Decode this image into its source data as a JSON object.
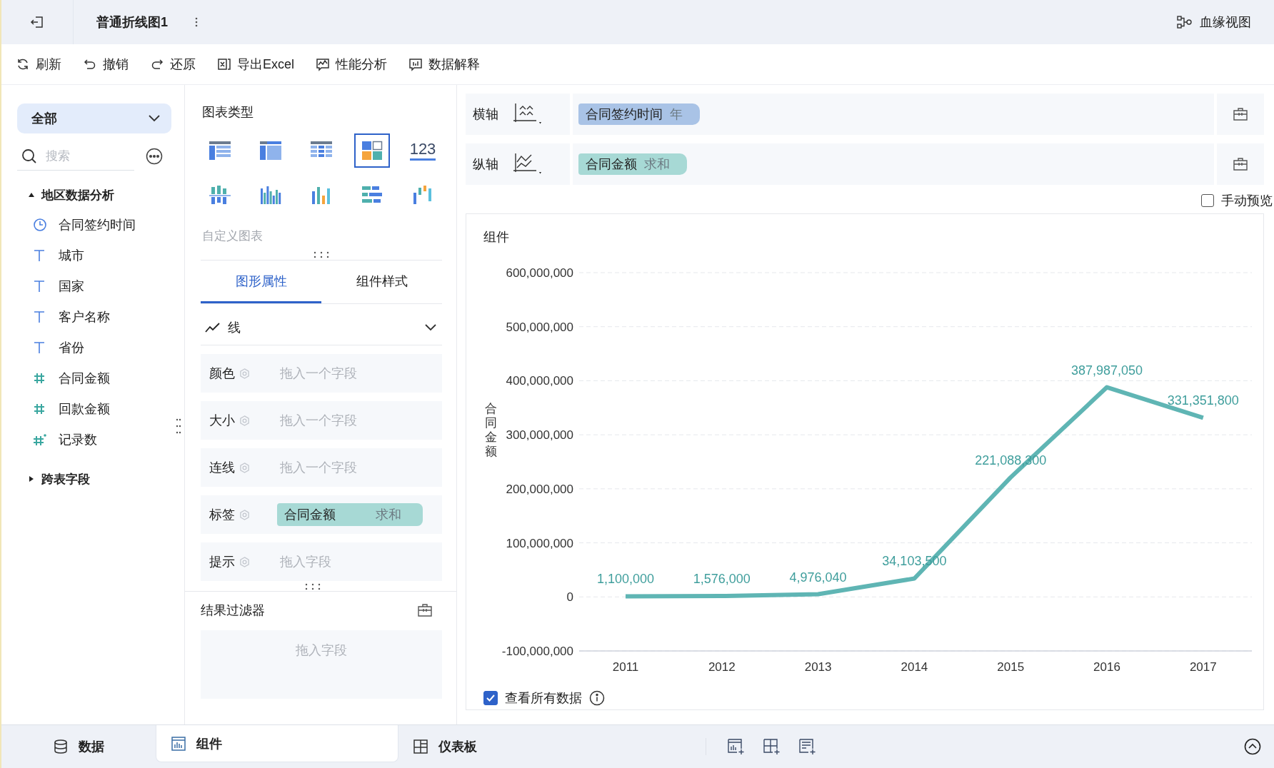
{
  "header": {
    "title": "普通折线图1",
    "lineage": "血缘视图"
  },
  "toolbar": [
    {
      "label": "刷新",
      "kind": "refresh"
    },
    {
      "label": "撤销",
      "kind": "undo"
    },
    {
      "label": "还原",
      "kind": "redo"
    },
    {
      "label": "导出Excel",
      "kind": "excel"
    },
    {
      "label": "性能分析",
      "kind": "performance"
    },
    {
      "label": "数据解释",
      "kind": "explain"
    }
  ],
  "data_panel": {
    "dropdown": "全部",
    "search": {
      "placeholder": "搜索"
    },
    "tree": [
      {
        "label": "地区数据分析",
        "expanded": true,
        "children": [
          {
            "label": "合同签约时间",
            "kind": "date"
          },
          {
            "label": "城市",
            "kind": "text"
          },
          {
            "label": "国家",
            "kind": "text"
          },
          {
            "label": "客户名称",
            "kind": "text"
          },
          {
            "label": "省份",
            "kind": "text"
          },
          {
            "label": "合同金额",
            "kind": "number"
          },
          {
            "label": "回款金额",
            "kind": "number"
          },
          {
            "label": "记录数",
            "kind": "count"
          }
        ]
      },
      {
        "label": "跨表字段",
        "expanded": false
      }
    ]
  },
  "chart_types": {
    "title": "图表类型",
    "custom": "自定义图表",
    "types": [
      {
        "kind": "cross-table",
        "selected": false
      },
      {
        "kind": "group-table",
        "selected": false
      },
      {
        "kind": "detail-table",
        "selected": false
      },
      {
        "kind": "custom",
        "selected": true
      },
      {
        "kind": "kpi",
        "label": "123",
        "selected": false
      },
      {
        "kind": "grouped-bar",
        "selected": false
      },
      {
        "kind": "multi-bar",
        "selected": false
      },
      {
        "kind": "bar",
        "selected": false
      },
      {
        "kind": "horizontal-bar",
        "selected": false
      },
      {
        "kind": "waterfall",
        "selected": false
      }
    ]
  },
  "prop_tabs": [
    {
      "label": "图形属性",
      "selected": true
    },
    {
      "label": "组件样式",
      "selected": false
    }
  ],
  "mark": {
    "type": "线",
    "rows": [
      {
        "label": "颜色",
        "placeholder": "拖入一个字段"
      },
      {
        "label": "大小",
        "placeholder": "拖入一个字段"
      },
      {
        "label": "连线",
        "placeholder": "拖入一个字段"
      },
      {
        "label": "标签",
        "field": {
          "name": "合同金额",
          "aggregation": "求和"
        }
      },
      {
        "label": "提示",
        "placeholder": "拖入字段"
      }
    ]
  },
  "result_filter": {
    "title": "结果过滤器",
    "placeholder": "拖入字段"
  },
  "axes": [
    {
      "label": "横轴",
      "kind": "x",
      "field": "合同签约时间",
      "suffix": "年",
      "color": "#a9c3e6"
    },
    {
      "label": "纵轴",
      "kind": "y",
      "field": "合同金额",
      "suffix": "求和",
      "color": "#a7d9d5"
    }
  ],
  "manual_preview": {
    "label": "手动预览",
    "checked": false
  },
  "chart": {
    "title": "组件",
    "chart_data": {
      "type": "line",
      "ylabel": "合同金额",
      "categories": [
        "2011",
        "2012",
        "2013",
        "2014",
        "2015",
        "2016",
        "2017"
      ],
      "series": [
        {
          "color": "#5fb5b4",
          "values": [
            1100000,
            1576000,
            4976040,
            34103500,
            221088300,
            387987050,
            331351800
          ],
          "value_labels": [
            "1,100,000",
            "1,576,000",
            "4,976,040",
            "34,103,500",
            "221,088,300",
            "387,987,050",
            "331,351,800"
          ]
        }
      ],
      "grid": true,
      "ylim": [
        -100000000,
        600000000
      ],
      "yticks": [
        {
          "value": -100000000,
          "label": "-100,000,000"
        },
        {
          "value": 0,
          "label": "0"
        },
        {
          "value": 100000000,
          "label": "100,000,000"
        },
        {
          "value": 200000000,
          "label": "200,000,000"
        },
        {
          "value": 300000000,
          "label": "300,000,000"
        },
        {
          "value": 400000000,
          "label": "400,000,000"
        },
        {
          "value": 500000000,
          "label": "500,000,000"
        },
        {
          "value": 600000000,
          "label": "600,000,000"
        }
      ],
      "legend": false
    }
  },
  "view_all": {
    "label": "查看所有数据",
    "checked": true
  },
  "bottom_tabs": [
    {
      "label": "数据",
      "kind": "data",
      "selected": false
    },
    {
      "label": "组件",
      "kind": "component",
      "selected": true
    },
    {
      "label": "仪表板",
      "kind": "dashboard",
      "selected": false
    }
  ]
}
